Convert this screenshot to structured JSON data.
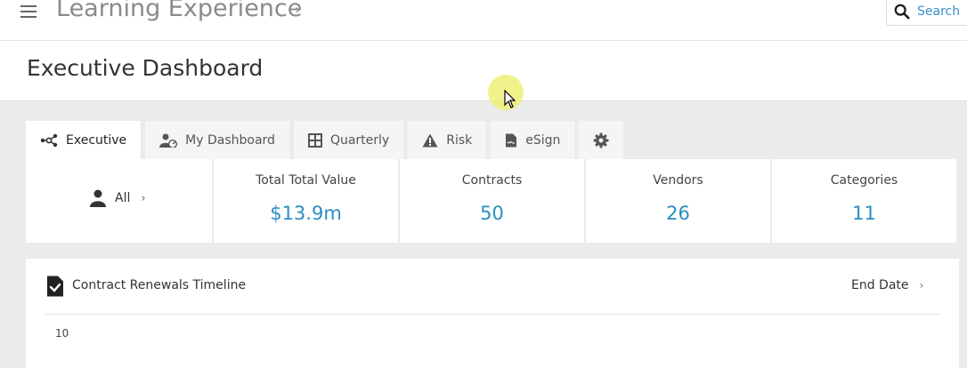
{
  "topbar": {
    "app_title": "Learning Experience",
    "search_placeholder": "Search"
  },
  "header": {
    "page_title": "Executive Dashboard"
  },
  "tabs": [
    {
      "label": "Executive",
      "icon": "network-nodes-icon",
      "active": true
    },
    {
      "label": "My Dashboard",
      "icon": "user-speedometer-icon",
      "active": false
    },
    {
      "label": "Quarterly",
      "icon": "grid-icon",
      "active": false
    },
    {
      "label": "Risk",
      "icon": "warning-triangle-icon",
      "active": false
    },
    {
      "label": "eSign",
      "icon": "signed-document-icon",
      "active": false
    },
    {
      "label": "",
      "icon": "gear-icon",
      "active": false
    }
  ],
  "user_filter": {
    "label": "All",
    "icon": "user-icon"
  },
  "stats": [
    {
      "label": "Total Total Value",
      "value": "$13.9m"
    },
    {
      "label": "Contracts",
      "value": "50"
    },
    {
      "label": "Vendors",
      "value": "26"
    },
    {
      "label": "Categories",
      "value": "11"
    }
  ],
  "panel": {
    "title": "Contract Renewals Timeline",
    "icon": "document-check-icon",
    "sort_label": "End Date",
    "y_tick": "10"
  },
  "colors": {
    "accent": "#2a8dc2",
    "search_text": "#3a8fc7",
    "background": "#ebebeb"
  }
}
